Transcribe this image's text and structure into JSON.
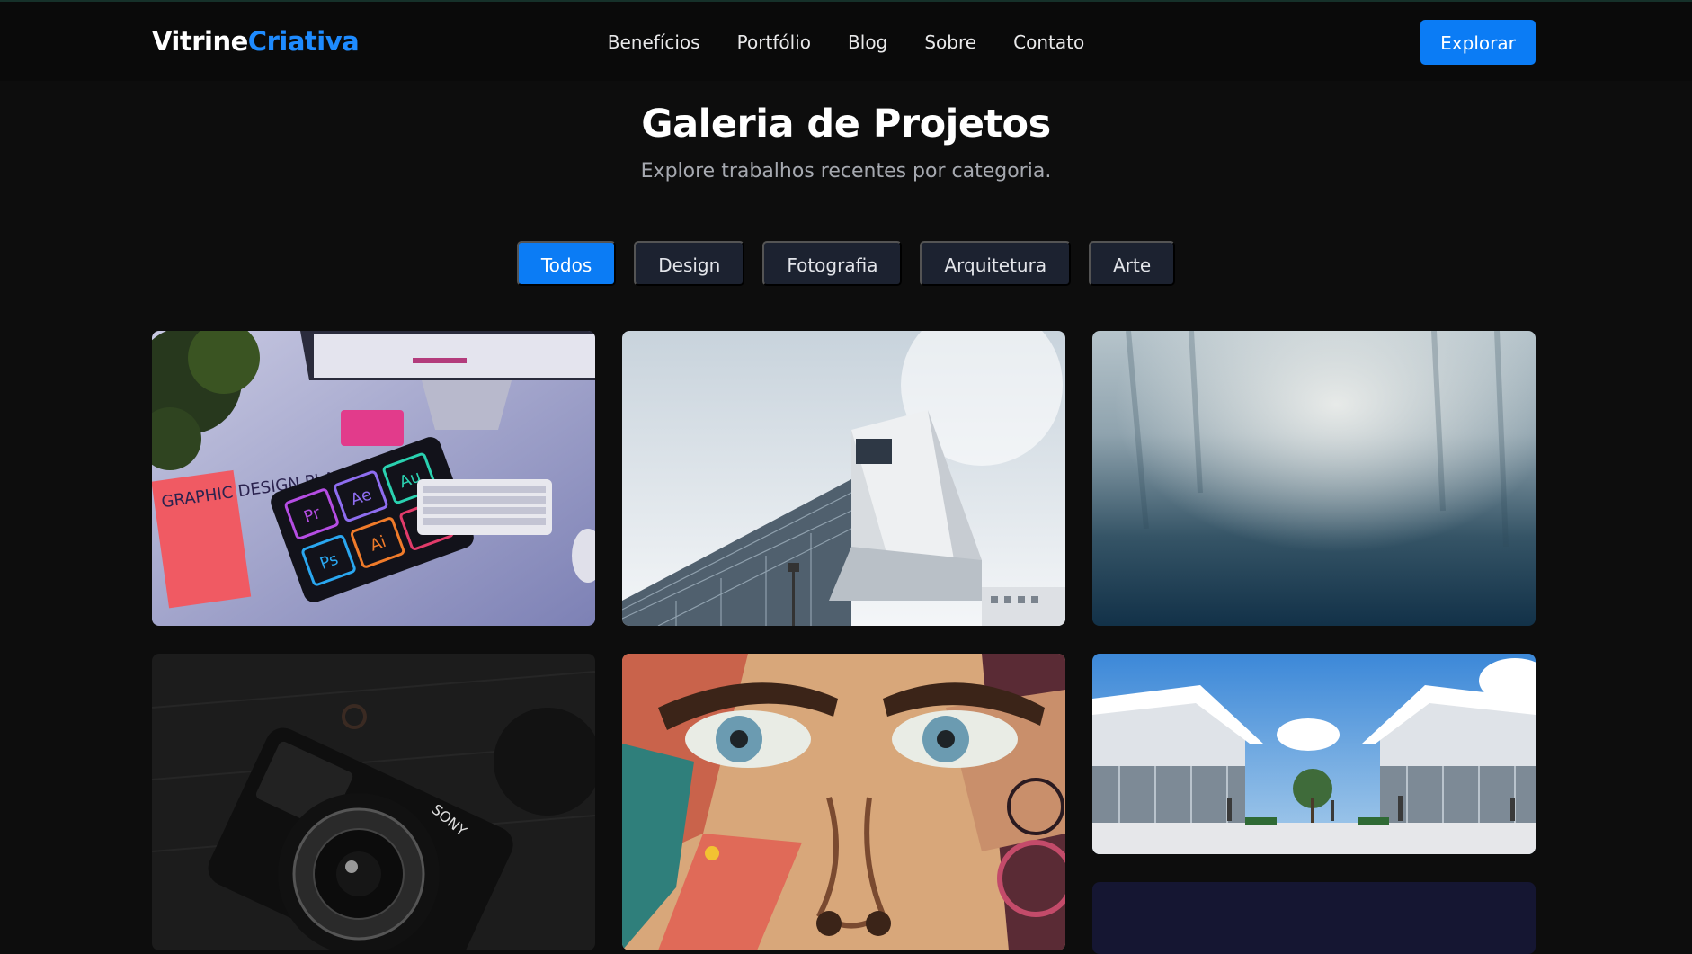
{
  "brand": {
    "part1": "Vitrine",
    "part2": "Criativa",
    "accent": "#1e8bff"
  },
  "nav": {
    "items": [
      "Benefícios",
      "Portfólio",
      "Blog",
      "Sobre",
      "Contato"
    ],
    "cta": "Explorar"
  },
  "hero": {
    "title": "Galeria de Projetos",
    "subtitle": "Explore trabalhos recentes por categoria."
  },
  "filters": {
    "items": [
      "Todos",
      "Design",
      "Fotografia",
      "Arquitetura",
      "Arte"
    ],
    "active": "Todos"
  },
  "gallery": {
    "items": [
      {
        "subject": "desk-with-creative-apps-tablet",
        "book_text": "GRAPHIC DESIGN PLAY BOOK",
        "app_icons": [
          "Pr",
          "Ae",
          "Au",
          "Ps",
          "Ai",
          "St"
        ]
      },
      {
        "subject": "modern-glass-building"
      },
      {
        "subject": "misty-blue-abstract"
      },
      {
        "subject": "camera-on-dark-table",
        "camera_brand": "SONY"
      },
      {
        "subject": "street-art-face-mural"
      },
      {
        "subject": "commercial-architecture-render"
      },
      {
        "subject": "dark-navy-card"
      }
    ]
  },
  "colors": {
    "background": "#0d0d0d",
    "header": "#0a0a0a",
    "primary": "#0b7cf5",
    "chip": "#1c2230",
    "muted_text": "#a6a9b0"
  }
}
